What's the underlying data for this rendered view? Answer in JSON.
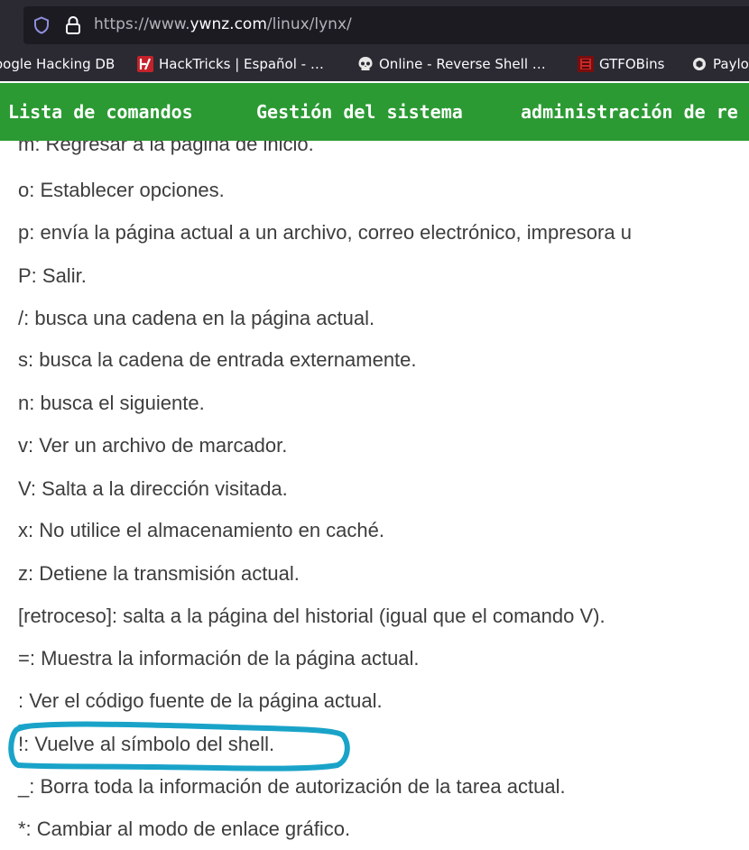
{
  "browser": {
    "url_prefix": "https://www.",
    "url_domain": "ywnz.com",
    "url_path": "/linux/lynx/",
    "bookmarks": [
      {
        "label": "oogle Hacking DB",
        "icon": "none"
      },
      {
        "label": "HackTricks | Español - …",
        "icon": "hacktricks-icon"
      },
      {
        "label": "Online - Reverse Shell …",
        "icon": "skull-icon"
      },
      {
        "label": "GTFOBins",
        "icon": "gtfobins-icon"
      },
      {
        "label": "Paylo",
        "icon": "payloads-icon"
      }
    ]
  },
  "nav": {
    "items": [
      "Lista de comandos",
      "Gestión del sistema",
      "administración de re"
    ]
  },
  "colors": {
    "nav_bg": "#2b9a33",
    "chrome_bg": "#2b2a33",
    "highlight": "#1aa3c9"
  },
  "commands": [
    "m: Regresar a la página de inicio.",
    "o: Establecer opciones.",
    "p: envía la página actual a un archivo, correo electrónico, impresora u",
    "P: Salir.",
    "/: busca una cadena en la página actual.",
    "s: busca la cadena de entrada externamente.",
    "n: busca el siguiente.",
    "v: Ver un archivo de marcador.",
    "V: Salta a la dirección visitada.",
    "x: No utilice el almacenamiento en caché.",
    "z: Detiene la transmisión actual.",
    "[retroceso]: salta a la página del historial (igual que el comando V).",
    "=: Muestra la información de la página actual.",
    ": Ver el código fuente de la página actual.",
    "!: Vuelve al símbolo del shell.",
    "_: Borra toda la información de autorización de la tarea actual.",
    "*: Cambiar al modo de enlace gráfico."
  ],
  "highlighted_command_index": 14
}
